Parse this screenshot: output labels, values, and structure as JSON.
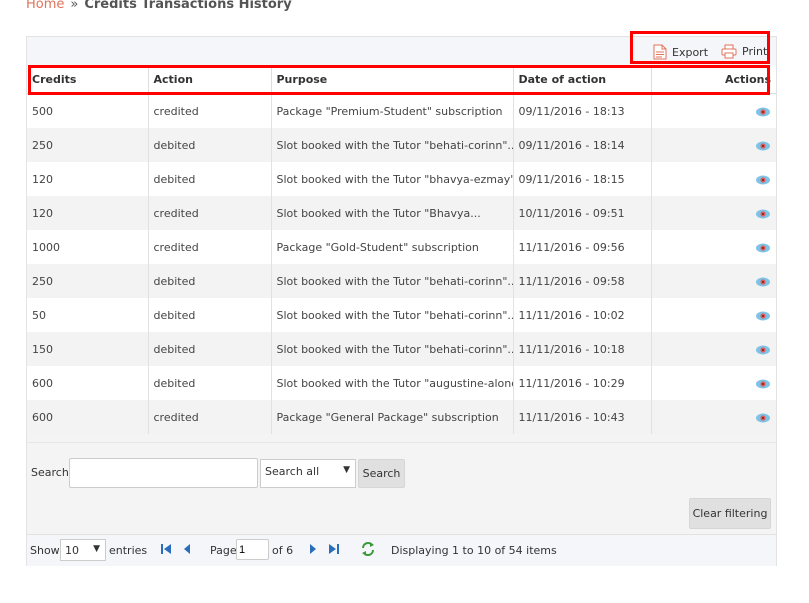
{
  "breadcrumb": {
    "home": "Home",
    "separator": "»",
    "current": "Credits Transactions History"
  },
  "toolbar": {
    "export_label": "Export",
    "print_label": "Print"
  },
  "table": {
    "columns": [
      "Credits",
      "Action",
      "Purpose",
      "Date of action",
      "Actions"
    ],
    "rows": [
      [
        "500",
        "credited",
        "Package \"Premium-Student\" subscription",
        "09/11/2016 - 18:13"
      ],
      [
        "250",
        "debited",
        "Slot booked with the Tutor \"behati-corinn\"...",
        "09/11/2016 - 18:14"
      ],
      [
        "120",
        "debited",
        "Slot booked with the Tutor \"bhavya-ezmay\"...",
        "09/11/2016 - 18:15"
      ],
      [
        "120",
        "credited",
        "Slot booked with the Tutor \"Bhavya...",
        "10/11/2016 - 09:51"
      ],
      [
        "1000",
        "credited",
        "Package \"Gold-Student\" subscription",
        "11/11/2016 - 09:56"
      ],
      [
        "250",
        "debited",
        "Slot booked with the Tutor \"behati-corinn\"...",
        "11/11/2016 - 09:58"
      ],
      [
        "50",
        "debited",
        "Slot booked with the Tutor \"behati-corinn\"...",
        "11/11/2016 - 10:02"
      ],
      [
        "150",
        "debited",
        "Slot booked with the Tutor \"behati-corinn\"...",
        "11/11/2016 - 10:18"
      ],
      [
        "600",
        "debited",
        "Slot booked with the Tutor \"augustine-alondra\"...",
        "11/11/2016 - 10:29"
      ],
      [
        "600",
        "credited",
        "Package \"General Package\" subscription",
        "11/11/2016 - 10:43"
      ]
    ],
    "row_action_icon": "eye-icon"
  },
  "filter": {
    "search_label": "Search:",
    "search_value": "",
    "scope_selected": "Search all",
    "search_button": "Search",
    "clear_button": "Clear filtering"
  },
  "pagination": {
    "show_label": "Show",
    "page_size": "10",
    "entries_label": "entries",
    "page_label": "Page",
    "page_value": "1",
    "of_label": "of 6",
    "display_text": "Displaying 1 to 10 of 54 items"
  },
  "colors": {
    "accent": "#e0735b",
    "highlight": "#ff0000",
    "nav_blue": "#2a6ebb",
    "refresh_green": "#3a9a3a"
  }
}
